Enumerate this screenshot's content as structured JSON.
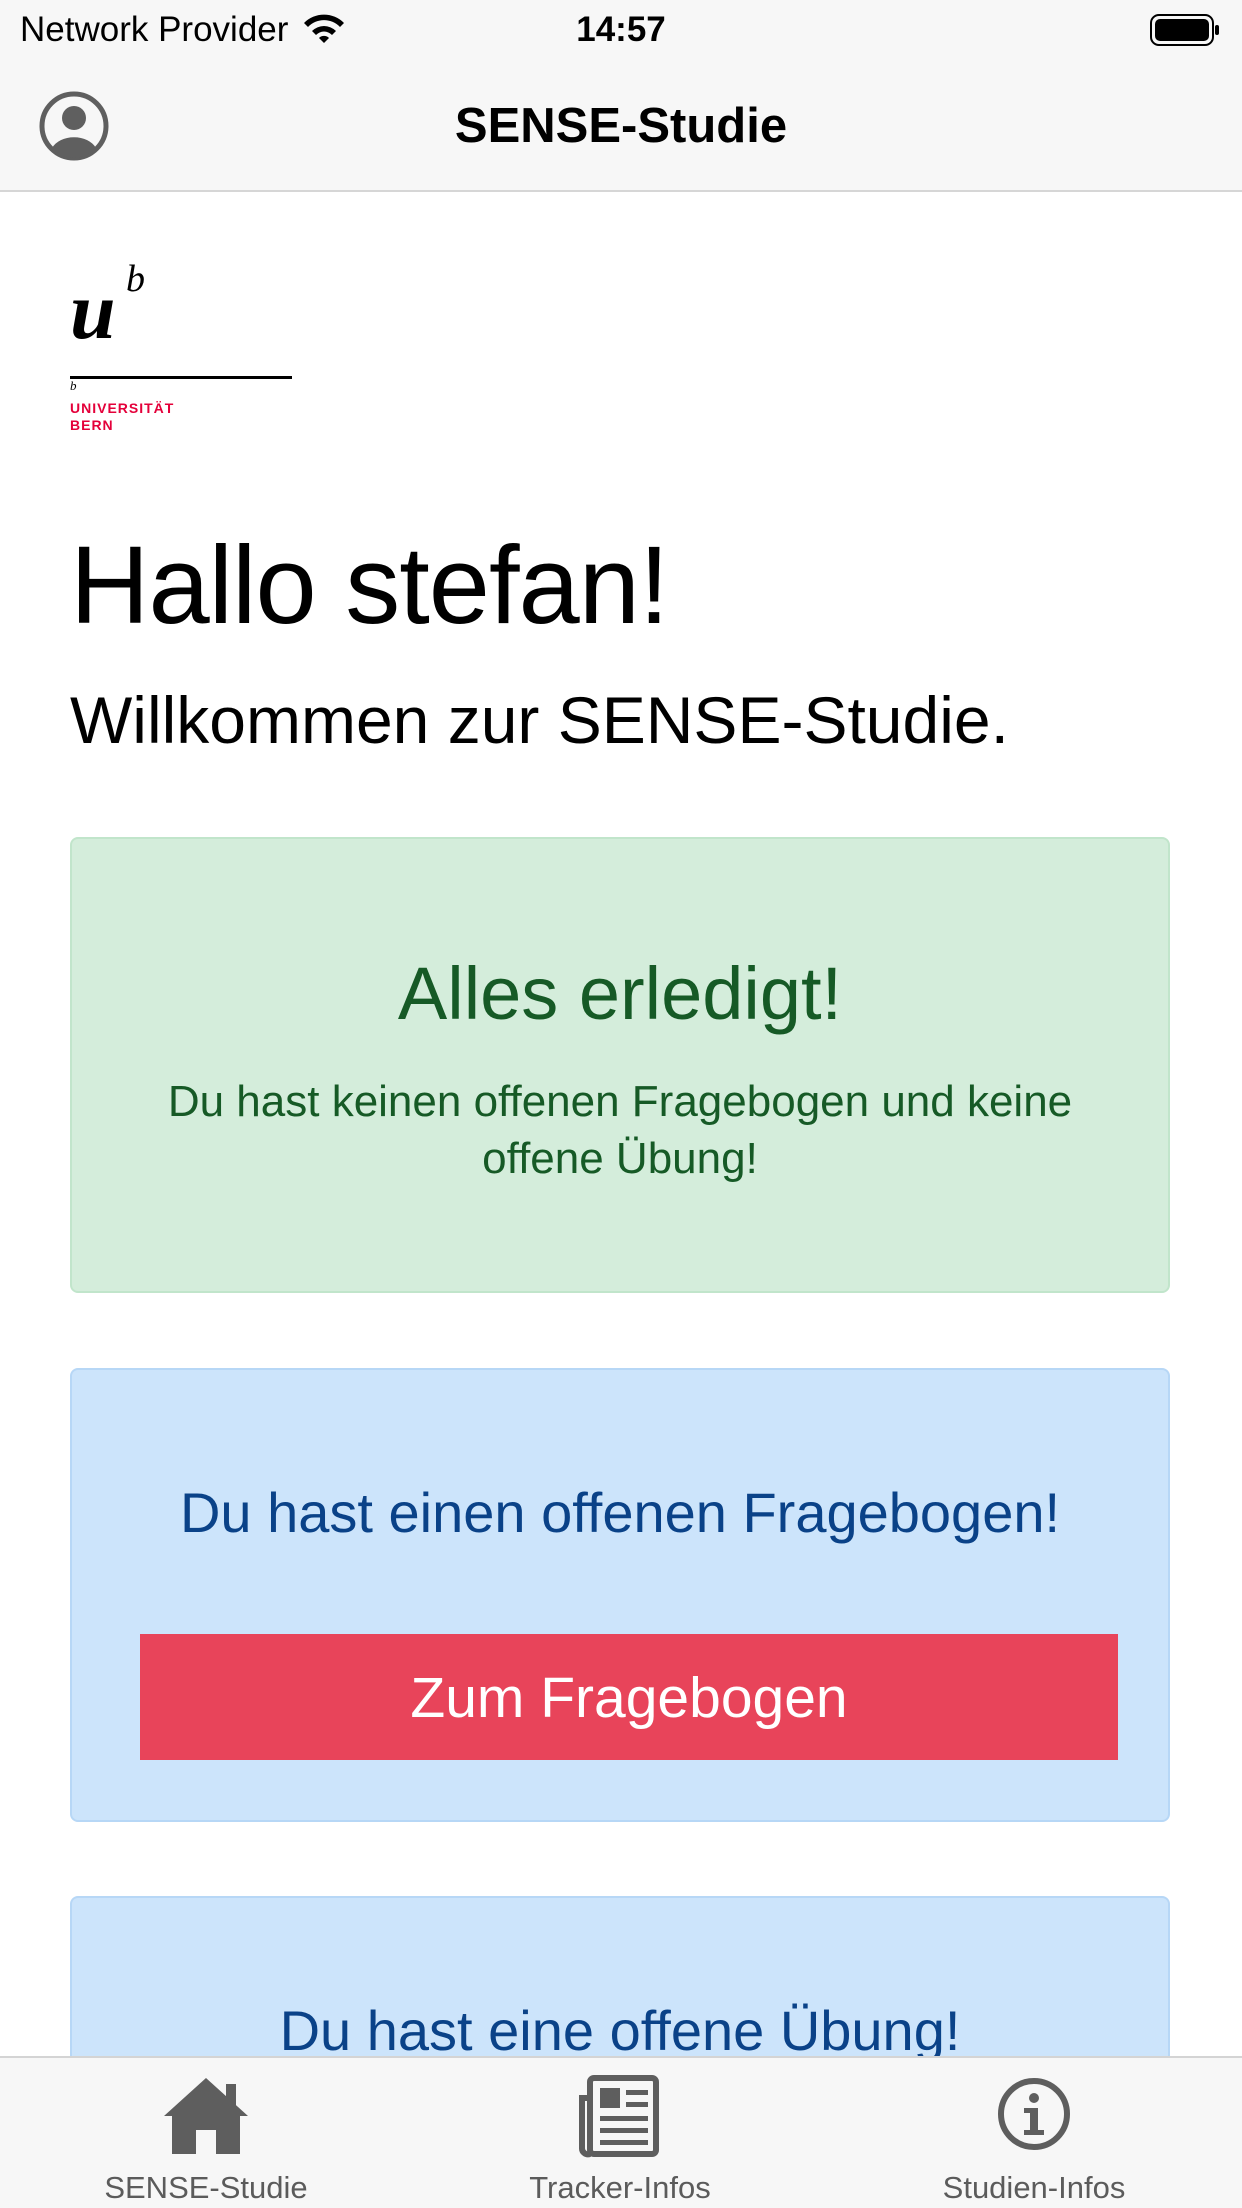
{
  "status_bar": {
    "carrier": "Network Provider",
    "time": "14:57"
  },
  "nav": {
    "title": "SENSE-Studie"
  },
  "logo": {
    "mark": "u",
    "superscript": "b",
    "small": "b",
    "line1": "UNIVERSITÄT",
    "line2": "BERN"
  },
  "main": {
    "greeting": "Hallo stefan!",
    "welcome": "Willkommen zur SENSE-Studie.",
    "success_card": {
      "title": "Alles erledigt!",
      "text": "Du hast keinen offenen Fragebogen und keine offene Übung!"
    },
    "questionnaire_card": {
      "title": "Du hast einen offenen Fragebogen!",
      "button": "Zum Fragebogen"
    },
    "exercise_card": {
      "title": "Du hast eine offene Übung!"
    }
  },
  "tabs": [
    {
      "label": "SENSE-Studie",
      "icon": "home-icon"
    },
    {
      "label": "Tracker-Infos",
      "icon": "newspaper-icon"
    },
    {
      "label": "Studien-Infos",
      "icon": "info-circle-icon"
    }
  ],
  "colors": {
    "success_bg": "#d4eddb",
    "success_text": "#165a26",
    "info_bg": "#cce4fb",
    "info_text": "#0a4288",
    "button_bg": "#e8445a",
    "brand_red": "#e4003a"
  }
}
